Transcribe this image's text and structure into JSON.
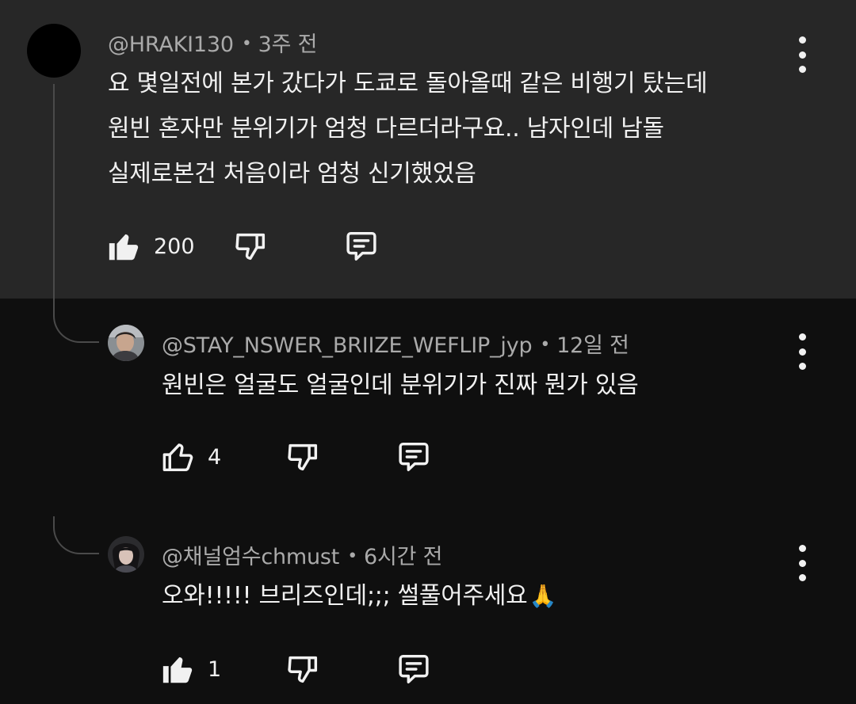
{
  "comments": [
    {
      "author": "@HRAKI130",
      "time": "3주 전",
      "lines": [
        "요 몇일전에 본가 갔다가 도쿄로 돌아올때 같은 비행기 탔는데",
        "원빈 혼자만 분위기가 엄청 다르더라구요.. 남자인데 남돌",
        "실제로본건 처음이라 엄청 신기했었음"
      ],
      "likes": "200",
      "like_state": "liked",
      "avatar": "black-circle-avatar"
    },
    {
      "author": "@STAY_NSWER_BRIIZE_WEFLIP_jyp",
      "time": "12일 전",
      "text": "원빈은 얼굴도 얼굴인데 분위기가 진짜 뭔가 있음",
      "likes": "4",
      "like_state": "not-liked",
      "avatar": "photo-avatar"
    },
    {
      "author": "@채널엄수chmust",
      "time": "6시간 전",
      "text": "오와!!!!! 브리즈인데;;; 썰풀어주세요",
      "emoji": "🙏",
      "likes": "1",
      "like_state": "liked",
      "avatar": "photo-avatar"
    }
  ],
  "separator": "•",
  "icons": {
    "like_filled": "thumbs-up-filled-icon",
    "like_outline": "thumbs-up-outline-icon",
    "dislike": "thumbs-down-outline-icon",
    "reply": "comment-reply-icon",
    "menu": "more-vertical-icon"
  },
  "colors": {
    "background": "#0f0f0f",
    "highlight_background": "#272727",
    "text_primary": "#f1f1f1",
    "text_secondary": "#aaaaaa",
    "thread_line": "#4a4a4a"
  }
}
